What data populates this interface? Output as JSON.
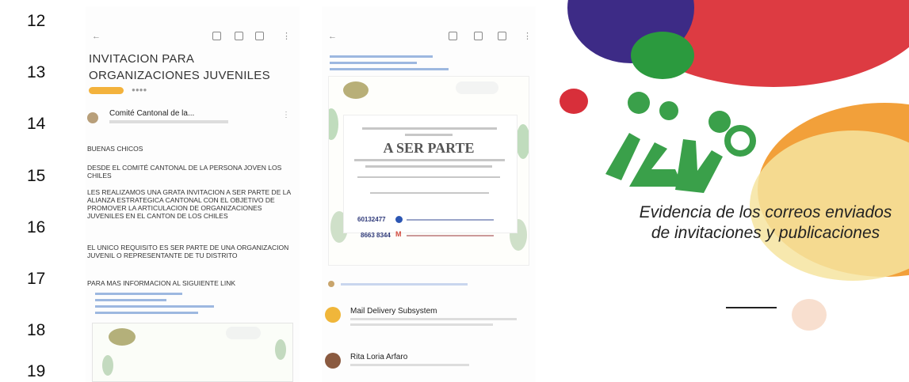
{
  "row_numbers": [
    "12",
    "13",
    "14",
    "15",
    "16",
    "17",
    "18",
    "19"
  ],
  "email_1": {
    "subject": "INVITACION PARA ORGANIZACIONES JUVENILES",
    "sender": "Comité Cantonal de la...",
    "greeting": "BUENAS CHICOS",
    "paragraph_1": "DESDE EL COMITÉ CANTONAL DE LA PERSONA JOVEN LOS CHILES",
    "paragraph_2": "LES REALIZAMOS UNA GRATA INVITACION A SER PARTE DE LA ALIANZA ESTRATEGICA CANTONAL CON EL OBJETIVO DE PROMOVER LA ARTICULACION DE ORGANIZACIONES JUVENILES EN EL CANTON DE LOS CHILES",
    "paragraph_3": "EL UNICO REQUISITO ES SER PARTE DE UNA ORGANIZACION JUVENIL O REPRESENTANTE DE TU DISTRITO",
    "paragraph_4": "PARA MAS INFORMACION AL SIGUIENTE LINK"
  },
  "email_2": {
    "flyer_title": "A SER PARTE",
    "phone_1": "60132477",
    "phone_2": "8663 8344",
    "thread_1_name": "Mail Delivery Subsystem",
    "thread_2_name": "Rita Loria Arfaro"
  },
  "panel": {
    "caption": "Evidencia de los correos enviados de invitaciones y publicaciones"
  },
  "colors": {
    "red": "#dd3b42",
    "purple": "#3d2b86",
    "orange": "#f2a03a",
    "green": "#3aa04a",
    "yellow": "#f6e4a0"
  }
}
